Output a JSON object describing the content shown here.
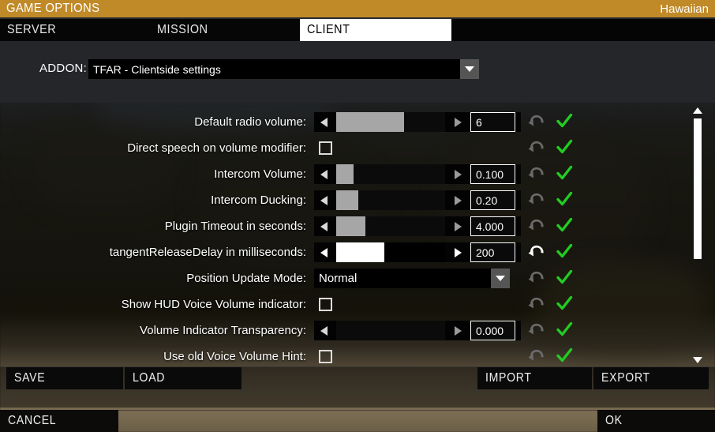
{
  "window": {
    "title": "GAME OPTIONS",
    "subtitle": "Hawaiian"
  },
  "tabs": [
    {
      "label": "SERVER",
      "active": false
    },
    {
      "label": "MISSION",
      "active": false
    },
    {
      "label": "CLIENT",
      "active": true
    }
  ],
  "addon": {
    "label": "ADDON:",
    "value": "TFAR - Clientside settings",
    "arrow_icon": "chevron-down-icon"
  },
  "settings": {
    "rows": [
      {
        "label": "Default radio volume:",
        "type": "slider",
        "value": "6",
        "fill_percent": 62,
        "highlighted": false,
        "undo_icon": "undo-arrow-icon",
        "status_icon": "green-check-icon"
      },
      {
        "label": "Direct speech on volume modifier:",
        "type": "checkbox",
        "checked": false,
        "highlighted": false,
        "undo_icon": "undo-arrow-icon",
        "status_icon": "green-check-icon"
      },
      {
        "label": "Intercom Volume:",
        "type": "slider",
        "value": "0.100",
        "fill_percent": 16,
        "highlighted": false,
        "undo_icon": "undo-arrow-icon",
        "status_icon": "green-check-icon"
      },
      {
        "label": "Intercom Ducking:",
        "type": "slider",
        "value": "0.20",
        "fill_percent": 20,
        "highlighted": false,
        "undo_icon": "undo-arrow-icon",
        "status_icon": "green-check-icon"
      },
      {
        "label": "Plugin Timeout in seconds:",
        "type": "slider",
        "value": "4.000",
        "fill_percent": 27,
        "highlighted": false,
        "undo_icon": "undo-arrow-icon",
        "status_icon": "green-check-icon"
      },
      {
        "label": "tangentReleaseDelay in milliseconds:",
        "type": "slider",
        "value": "200",
        "fill_percent": 44,
        "highlighted": true,
        "undo_icon": "undo-arrow-icon",
        "status_icon": "green-check-icon"
      },
      {
        "label": "Position Update Mode:",
        "type": "combo",
        "value": "Normal",
        "arrow_icon": "chevron-down-icon",
        "highlighted": false,
        "undo_icon": "undo-arrow-icon",
        "status_icon": "green-check-icon"
      },
      {
        "label": "Show HUD Voice Volume indicator:",
        "type": "checkbox",
        "checked": false,
        "highlighted": false,
        "undo_icon": "undo-arrow-icon",
        "status_icon": "green-check-icon"
      },
      {
        "label": "Volume Indicator Transparency:",
        "type": "slider",
        "value": "0.000",
        "fill_percent": 0,
        "highlighted": false,
        "undo_icon": "undo-arrow-icon",
        "status_icon": "green-check-icon"
      },
      {
        "label": "Use old Voice Volume Hint:",
        "type": "checkbox",
        "checked": false,
        "highlighted": false,
        "undo_icon": "undo-arrow-icon",
        "status_icon": "green-check-icon"
      }
    ],
    "scrollbar": {
      "up_icon": "triangle-up-icon",
      "down_icon": "triangle-down-icon"
    }
  },
  "action_bar": {
    "save": "SAVE",
    "load": "LOAD",
    "import": "IMPORT",
    "export": "EXPORT"
  },
  "footer": {
    "cancel": "CANCEL",
    "ok": "OK"
  },
  "colors": {
    "title_bar": "#c08a28",
    "active_tab_bg": "#ffffff",
    "status_check": "#22cc22",
    "slider_fill": "#a6a6a6",
    "slider_fill_hot": "#ffffff"
  }
}
